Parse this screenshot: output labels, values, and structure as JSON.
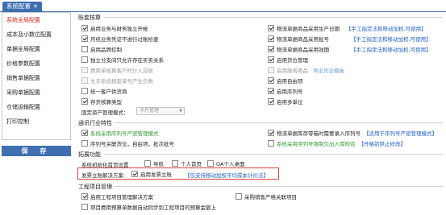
{
  "window": {
    "tab_label": "系统配置",
    "close_glyph": "✕"
  },
  "sidebar": {
    "items": [
      {
        "label": "系统全局配置",
        "active": true
      },
      {
        "label": "成本及小数位配置"
      },
      {
        "label": "单据全局配置"
      },
      {
        "label": "价格参数配置"
      },
      {
        "label": "销售单据配置"
      },
      {
        "label": "采购单据配置"
      },
      {
        "label": "仓储运输配置"
      },
      {
        "label": "打印控制"
      }
    ],
    "save_label": "保 存"
  },
  "sections": {
    "account": {
      "title": "账套核算",
      "left": [
        {
          "label": "启用业务与财务独立开帐",
          "checked": true
        },
        {
          "label": "月结业务凭证不进行过账检查",
          "checked": true
        },
        {
          "label": "启用品牌控制",
          "checked": false
        },
        {
          "label": "独立分支间只允许存在买卖关系",
          "checked": false
        },
        {
          "label": "费用单核算客户时计入应收",
          "checked": false,
          "disabled": true
        },
        {
          "label": "允许系统报废单号产生负数",
          "checked": false,
          "disabled": true
        },
        {
          "label": "统一客户供货商",
          "checked": false
        },
        {
          "label": "存货核算类型",
          "checked": true
        }
      ],
      "right": [
        {
          "label": "物流单据商品采用生产日期",
          "checked": true,
          "hint": "【手工指定法和移动加权,可使用】"
        },
        {
          "label": "物流单据商品采用批号",
          "checked": true,
          "hint": "【手工指定法和移动加权,可使用】"
        },
        {
          "label": "物流单据商品采用效期",
          "checked": true,
          "hint": "【手工指定法和移动加权,可使用】"
        },
        {
          "label": "启用货位管理",
          "checked": true
        },
        {
          "label": "启用服务商品",
          "checked": false,
          "disabled": true,
          "link": "导出凭证模板"
        },
        {
          "label": "启用自由项",
          "checked": true
        },
        {
          "label": "启用序列号",
          "checked": true
        },
        {
          "label": "启用多单位",
          "checked": true
        }
      ],
      "mode_label": "固定资产管理模式：",
      "mode_value": "卡片管理"
    },
    "industry": {
      "title": "通讯行业特性",
      "items": [
        {
          "label": "系统采用序列号严密管理模式",
          "checked": true,
          "style": "green"
        },
        {
          "label": "序列号关联货位，自由项，批次批号",
          "checked": false
        },
        {
          "label": "物流单据库存零箱时需要录入序列号",
          "checked": true,
          "hint": "【适用于序列号严密管理模式】"
        },
        {
          "label": "系统采用序列号强制欠出入库校验",
          "checked": false,
          "style": "green",
          "hint": "【开格前禁止修改】"
        }
      ]
    },
    "expand": {
      "title": "拓展功能",
      "homepage_label": "系统初始化首页设置",
      "homepage_options": [
        {
          "label": "导航",
          "checked": false
        },
        {
          "label": "个人首页",
          "checked": false
        },
        {
          "label": "OA个人桌面",
          "checked": false
        }
      ],
      "invoice_label": "发票立账解决方案:",
      "invoice_option": {
        "label": "启用发票立账",
        "checked": true
      },
      "invoice_hint": "【仅支持移动加权平均成本计价法】"
    },
    "project": {
      "title": "工程项目管理",
      "items": [
        {
          "label": "启用工程项目管理解决方案",
          "checked": true
        },
        {
          "label": "采购销售严格关联项目",
          "checked": false
        },
        {
          "label": "项目费用预算单数据自动同步到工程项目的预算金额上",
          "checked": false
        }
      ]
    }
  },
  "colors": {
    "accent": "#3f6fb0",
    "active": "#d8261d",
    "hint": "#1d5fc9",
    "green": "#2e9a2e",
    "highlight_box": "#e0413a"
  },
  "icons": {
    "select_arrow": "▼"
  }
}
